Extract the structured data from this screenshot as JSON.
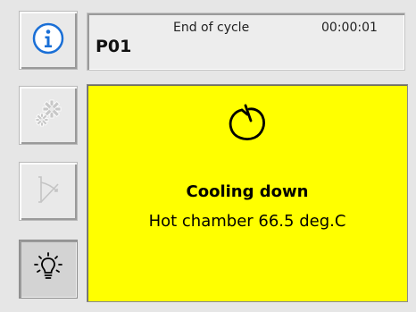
{
  "sidebar": {
    "buttons": [
      {
        "name": "info",
        "icon": "info-icon",
        "color": "#1a6fd6"
      },
      {
        "name": "settings",
        "icon": "gears-icon",
        "enabled": false
      },
      {
        "name": "program",
        "icon": "program-curve-icon",
        "enabled": false
      },
      {
        "name": "light",
        "icon": "light-bulb-icon",
        "pressed": true
      }
    ]
  },
  "header": {
    "program_id": "P01",
    "cycle_status": "End of cycle",
    "cycle_time": "00:00:01"
  },
  "status": {
    "background_color": "#ffff00",
    "icon": "cooling-icon",
    "title": "Cooling down",
    "detail": "Hot chamber 66.5 deg.C"
  }
}
